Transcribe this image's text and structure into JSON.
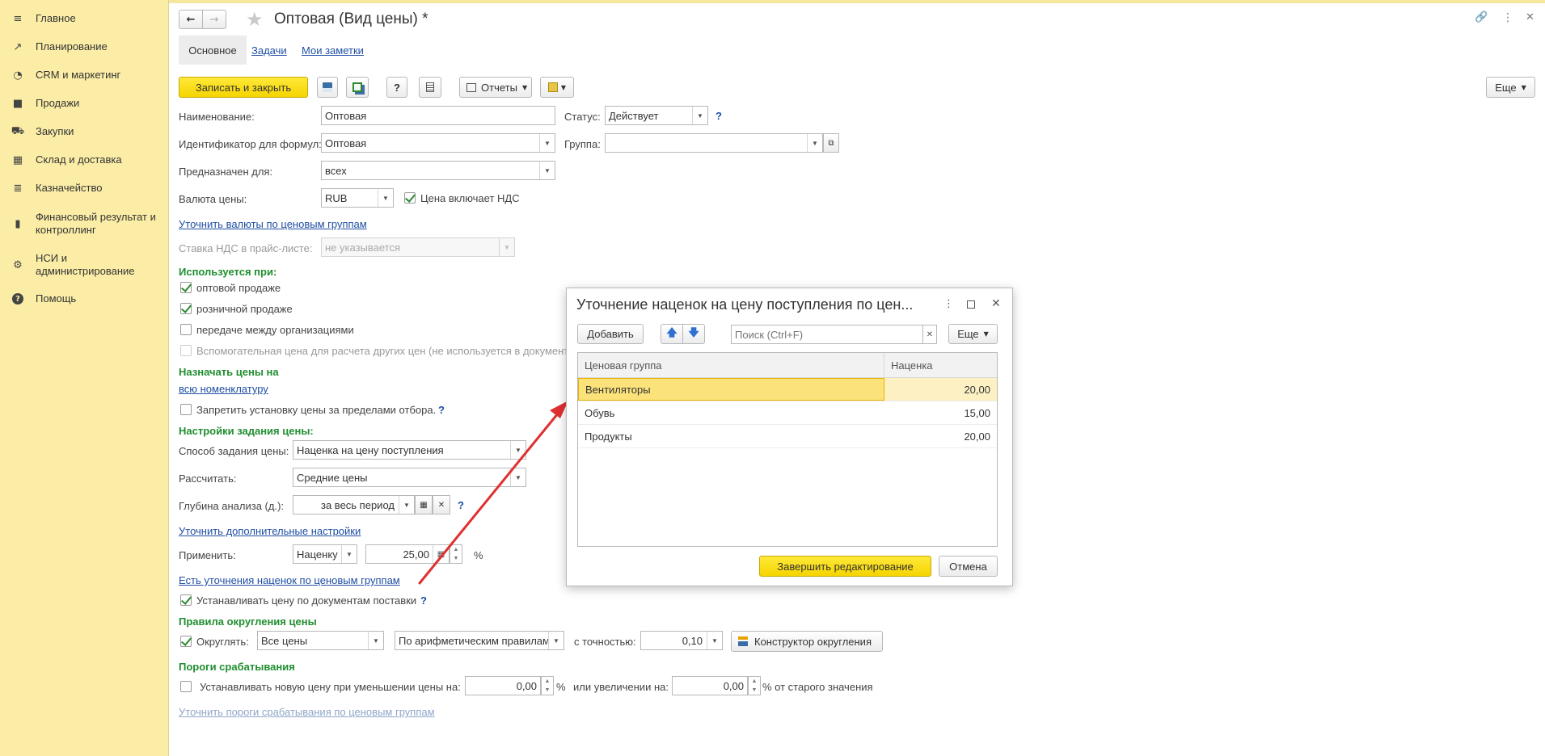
{
  "sidebar": {
    "items": [
      {
        "icon": "menu-icon",
        "glyph": "≡",
        "label": "Главное"
      },
      {
        "icon": "chart-up-icon",
        "glyph": "↗",
        "label": "Планирование"
      },
      {
        "icon": "pie-icon",
        "glyph": "◔",
        "label": "CRM и маркетинг"
      },
      {
        "icon": "bag-icon",
        "glyph": "■",
        "label": "Продажи"
      },
      {
        "icon": "cart-icon",
        "glyph": "⛟",
        "label": "Закупки"
      },
      {
        "icon": "warehouse-icon",
        "glyph": "▦",
        "label": "Склад и доставка"
      },
      {
        "icon": "coins-icon",
        "glyph": "≣",
        "label": "Казначейство"
      },
      {
        "icon": "bar-chart-icon",
        "glyph": "▮",
        "label": "Финансовый результат и контроллинг"
      },
      {
        "icon": "gear-icon",
        "glyph": "⚙",
        "label": "НСИ и администрирование"
      },
      {
        "icon": "help-icon",
        "glyph": "?",
        "label": "Помощь"
      }
    ]
  },
  "header": {
    "title": "Оптовая (Вид цены) *",
    "back": "←",
    "forward": "→",
    "star": "★",
    "link": "🔗",
    "more": "⋮",
    "close": "✕"
  },
  "tabs": [
    "Основное",
    "Задачи",
    "Мои заметки"
  ],
  "toolbar": {
    "save_close": "Записать и закрыть",
    "help": "?",
    "reports": "Отчеты",
    "more": "Еще"
  },
  "form": {
    "name_label": "Наименование:",
    "name_value": "Оптовая",
    "status_label": "Статус:",
    "status_value": "Действует",
    "formula_id_label": "Идентификатор для формул:",
    "formula_id_value": "Оптовая",
    "group_label": "Группа:",
    "group_value": "",
    "intended_label": "Предназначен для:",
    "intended_value": "всех",
    "currency_label": "Валюта цены:",
    "currency_value": "RUB",
    "vat_included": "Цена включает НДС",
    "clarify_currency_link": "Уточнить валюты по ценовым группам",
    "vat_rate_label": "Ставка НДС в прайс-листе:",
    "vat_rate_value": "не указывается",
    "used_heading": "Используется при:",
    "use_wholesale": "оптовой продаже",
    "use_retail": "розничной продаже",
    "use_transfer": "передаче между организациями",
    "use_auxiliary": "Вспомогательная цена для расчета других цен (не используется в документах)",
    "assign_heading": "Назначать цены на",
    "all_items_link": "всю номенклатуру",
    "prohibit_label": "Запретить установку цены за пределами отбора.",
    "settings_heading": "Настройки задания цены:",
    "method_label": "Способ задания цены:",
    "method_value": "Наценка на цену поступления",
    "calc_label": "Рассчитать:",
    "calc_value": "Средние цены",
    "depth_label": "Глубина анализа (д.):",
    "depth_value": "за весь период",
    "extra_settings_link": "Уточнить дополнительные настройки",
    "apply_label": "Применить:",
    "apply_value": "Наценку",
    "apply_amount": "25,00",
    "percent": "%",
    "markup_groups_link": "Есть уточнения наценок по ценовым группам",
    "set_by_docs": "Устанавливать цену по документам поставки",
    "rounding_heading": "Правила округления цены",
    "round_label": "Округлять:",
    "round_which": "Все цены",
    "round_rule": "По арифметическим правилам",
    "precision_label": "с точностью:",
    "precision_value": "0,10",
    "round_constructor": "Конструктор округления",
    "thresholds_heading": "Пороги срабатывания",
    "threshold_decrease": "Устанавливать новую цену при уменьшении цены на:",
    "threshold_decrease_value": "0,00",
    "threshold_increase": "или увеличении на:",
    "threshold_increase_value": "0,00",
    "threshold_suffix": "% от старого значения",
    "clarify_thresholds_link": "Уточнить пороги срабатывания по ценовым группам"
  },
  "dialog": {
    "title": "Уточнение наценок на цену поступления по цен...",
    "add": "Добавить",
    "search_placeholder": "Поиск (Ctrl+F)",
    "more": "Еще",
    "columns": [
      "Ценовая группа",
      "Наценка"
    ],
    "rows": [
      {
        "group": "Вентиляторы",
        "markup": "20,00"
      },
      {
        "group": "Обувь",
        "markup": "15,00"
      },
      {
        "group": "Продукты",
        "markup": "20,00"
      }
    ],
    "finish": "Завершить редактирование",
    "cancel": "Отмена"
  },
  "colors": {
    "sidebar_bg": "#fbeda6",
    "accent_yellow": "#f5d400",
    "heading_green": "#1f8e2e",
    "link_blue": "#1f4ea3",
    "arrow_red": "#e03030"
  }
}
